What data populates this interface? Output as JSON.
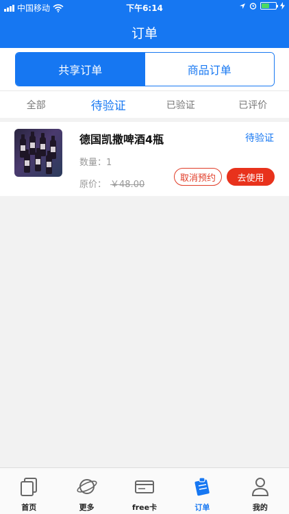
{
  "status_bar": {
    "carrier": "中国移动",
    "time": "下午6:14"
  },
  "header": {
    "title": "订单"
  },
  "segments": [
    {
      "label": "共享订单",
      "active": true
    },
    {
      "label": "商品订单",
      "active": false
    }
  ],
  "sub_tabs": [
    {
      "label": "全部",
      "active": false
    },
    {
      "label": "待验证",
      "active": true
    },
    {
      "label": "已验证",
      "active": false
    },
    {
      "label": "已评价",
      "active": false
    }
  ],
  "order": {
    "name": "德国凯撒啤酒4瓶",
    "status": "待验证",
    "quantity_label": "数量：",
    "quantity": "1",
    "price_label": "原价：",
    "price": "￥48.00",
    "cancel_label": "取消预约",
    "use_label": "去使用",
    "thumbnail_icon": "beer-bottles-image"
  },
  "tab_bar": [
    {
      "label": "首页",
      "icon": "home-icon",
      "active": false
    },
    {
      "label": "更多",
      "icon": "planet-icon",
      "active": false
    },
    {
      "label": "free卡",
      "icon": "card-icon",
      "active": false
    },
    {
      "label": "订单",
      "icon": "order-icon",
      "active": true
    },
    {
      "label": "我的",
      "icon": "user-icon",
      "active": false
    }
  ],
  "colors": {
    "primary": "#1677f2",
    "danger": "#e8321c",
    "background": "#f2f2f2"
  }
}
